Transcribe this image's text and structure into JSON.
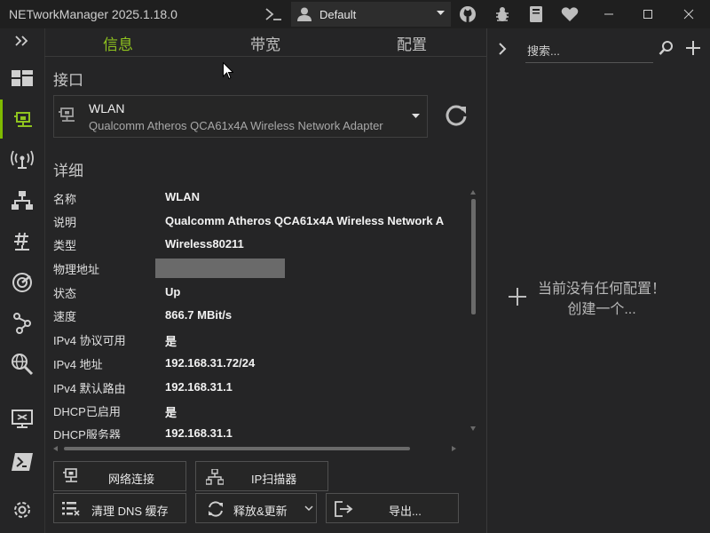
{
  "app": {
    "title": "NETworkManager 2025.1.18.0"
  },
  "profile": {
    "name": "Default"
  },
  "tabs": [
    {
      "label": "信息",
      "active": true
    },
    {
      "label": "带宽",
      "active": false
    },
    {
      "label": "配置",
      "active": false
    }
  ],
  "interface_section": {
    "title": "接口",
    "selected": {
      "name": "WLAN",
      "description": "Qualcomm Atheros QCA61x4A Wireless Network Adapter"
    }
  },
  "details": {
    "title": "详细",
    "rows": [
      {
        "label": "名称",
        "value": "WLAN"
      },
      {
        "label": "说明",
        "value": "Qualcomm Atheros QCA61x4A Wireless Network A"
      },
      {
        "label": "类型",
        "value": "Wireless80211"
      },
      {
        "label": "物理地址",
        "value": ""
      },
      {
        "label": "状态",
        "value": "Up"
      },
      {
        "label": "速度",
        "value": "866.7 MBit/s"
      },
      {
        "label": "IPv4 协议可用",
        "value": "是"
      },
      {
        "label": "IPv4 地址",
        "value": "192.168.31.72/24"
      },
      {
        "label": "IPv4 默认路由",
        "value": "192.168.31.1"
      },
      {
        "label": "DHCP已启用",
        "value": "是"
      },
      {
        "label": "DHCP服务器",
        "value": "192.168.31.1"
      }
    ]
  },
  "buttons": {
    "network_connections": "网络连接",
    "ip_scanner": "IP扫描器",
    "flush_dns": "清理 DNS 缓存",
    "release_renew": "释放&更新",
    "export": "导出..."
  },
  "search": {
    "placeholder": "搜索..."
  },
  "empty_state": {
    "line1": "当前没有任何配置！",
    "line2": "创建一个..."
  },
  "colors": {
    "accent": "#8fc31f",
    "background": "#252526",
    "titlebar": "#1f1f1f"
  }
}
